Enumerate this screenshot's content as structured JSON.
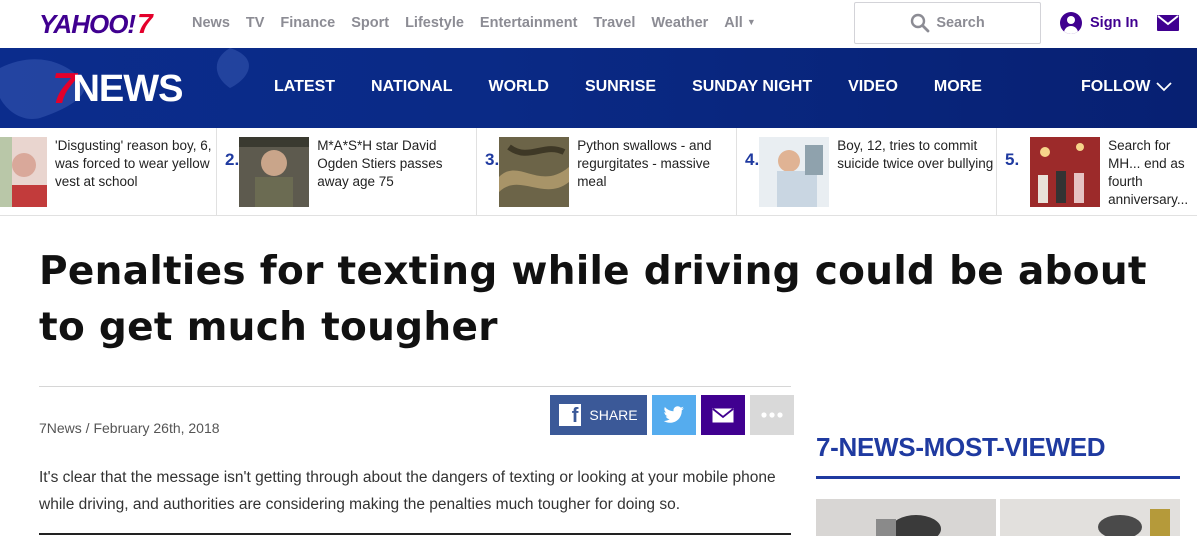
{
  "yahoo": {
    "logo": "YAHOO!",
    "logo_seven": "7",
    "nav": [
      "News",
      "TV",
      "Finance",
      "Sport",
      "Lifestyle",
      "Entertainment",
      "Travel",
      "Weather",
      "All"
    ],
    "search_label": "Search",
    "signin_label": "Sign In"
  },
  "news7": {
    "logo_seven": "7",
    "logo_text": "NEWS",
    "nav": [
      "LATEST",
      "NATIONAL",
      "WORLD",
      "SUNRISE",
      "SUNDAY NIGHT",
      "VIDEO",
      "MORE"
    ],
    "follow_label": "FOLLOW"
  },
  "trending": [
    {
      "num": "",
      "text": "'Disgusting' reason boy, 6, was forced to wear yellow vest at school"
    },
    {
      "num": "2.",
      "text": "M*A*S*H star David Ogden Stiers passes away age 75"
    },
    {
      "num": "3.",
      "text": "Python swallows - and regurgitates - massive meal"
    },
    {
      "num": "4.",
      "text": "Boy, 12, tries to commit suicide twice over bullying"
    },
    {
      "num": "5.",
      "text": "Search for MH... end as fourth anniversary..."
    }
  ],
  "article": {
    "headline": "Penalties for texting while driving could be about to get much tougher",
    "byline": "7News / February 26th, 2018",
    "lede": "It's clear that the message isn't getting through about the dangers of texting or looking at your mobile phone while driving, and authorities are considering making the penalties much tougher for doing so."
  },
  "share": {
    "facebook_label": "SHARE"
  },
  "sidebar": {
    "title": "7-NEWS-MOST-VIEWED"
  },
  "colors": {
    "yahoo_purple": "#400090",
    "news_blue": "#0b2c8c",
    "accent_red": "#e4002b",
    "facebook": "#3b5998",
    "twitter": "#55acee"
  }
}
